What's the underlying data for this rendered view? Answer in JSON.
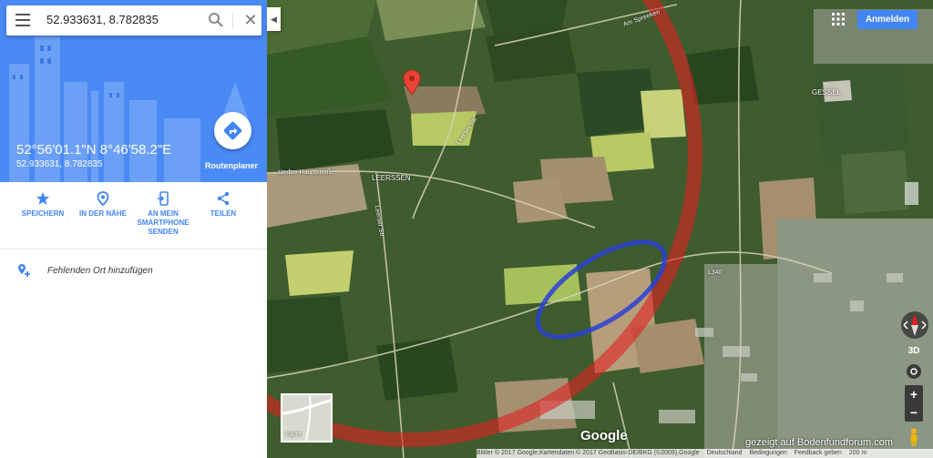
{
  "search": {
    "value": "52.933631, 8.782835",
    "menu_icon": "menu-icon",
    "search_icon": "search-icon",
    "clear_icon": "close-icon",
    "clear_glyph": "✕"
  },
  "place": {
    "dms": "52°56'01.1\"N 8°46'58.2\"E",
    "decimal": "52.933631, 8.782835",
    "route_label": "Routenplaner"
  },
  "actions": [
    {
      "label": "SPEICHERN",
      "icon": "star-icon"
    },
    {
      "label": "IN DER NÄHE",
      "icon": "nearby-icon"
    },
    {
      "label": "AN MEIN SMARTPHONE SENDEN",
      "icon": "send-to-phone-icon"
    },
    {
      "label": "TEILEN",
      "icon": "share-icon"
    }
  ],
  "missing_place": "Fehlenden Ort hinzufügen",
  "collapse_glyph": "◀",
  "header": {
    "signin": "Anmelden"
  },
  "map_labels": {
    "am_spreeken": "Am Spreeken",
    "gessel": "GESSEL",
    "leerssen": "LEERSSEN",
    "leerser_str": "Leerser Str.",
    "hauptstrasse": "stedter Hauptstraße",
    "l340": "L340",
    "leerser_str_2": "Leerser Str."
  },
  "controls": {
    "btn3d": "3D",
    "zoom_in": "+",
    "zoom_out": "−"
  },
  "minimap_label": "Karte",
  "google_logo": "Google",
  "watermark": "gezeigt auf Bodenfundforum.com",
  "footer": {
    "imagery": "Bilder © 2017 Google,Kartendaten © 2017 GeoBasis-DE/BKG (©2009),Google",
    "country": "Deutschland",
    "terms": "Bedingungen",
    "feedback": "Feedback geben",
    "scale": "200 m"
  },
  "colors": {
    "accent": "#4285f4",
    "hero": "#4a8af4",
    "red_circle": "#e02020",
    "blue_ellipse": "#2a3fd6",
    "pin": "#e84335"
  }
}
